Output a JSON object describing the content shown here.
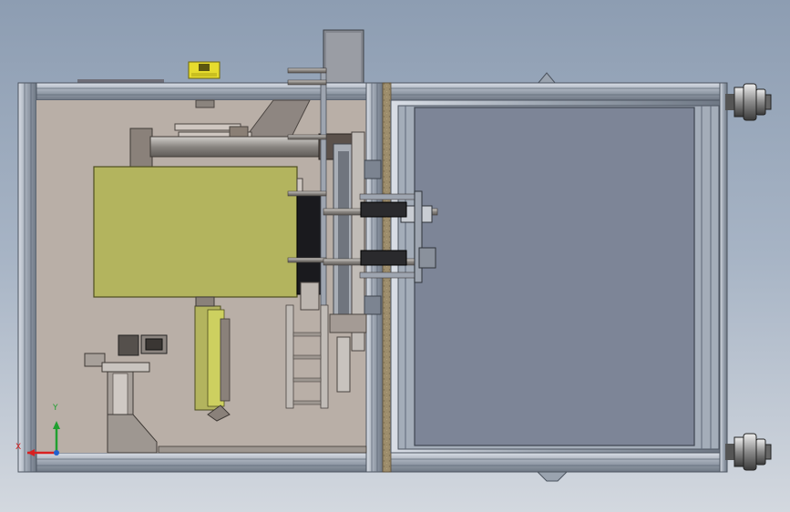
{
  "colors": {
    "frame": "#aab4c1",
    "frame_dark": "#5e6876",
    "interior_left": "#b9afa7",
    "interior_right": "#7d8597",
    "panel_yellow": "#b3b45e",
    "wood_strip": "#9d8d6c",
    "axis_x": "#d82020",
    "axis_y": "#20a030",
    "cad_yellow": "#e6dc2e"
  },
  "triad": {
    "x_label": "X",
    "y_label": "Y"
  }
}
